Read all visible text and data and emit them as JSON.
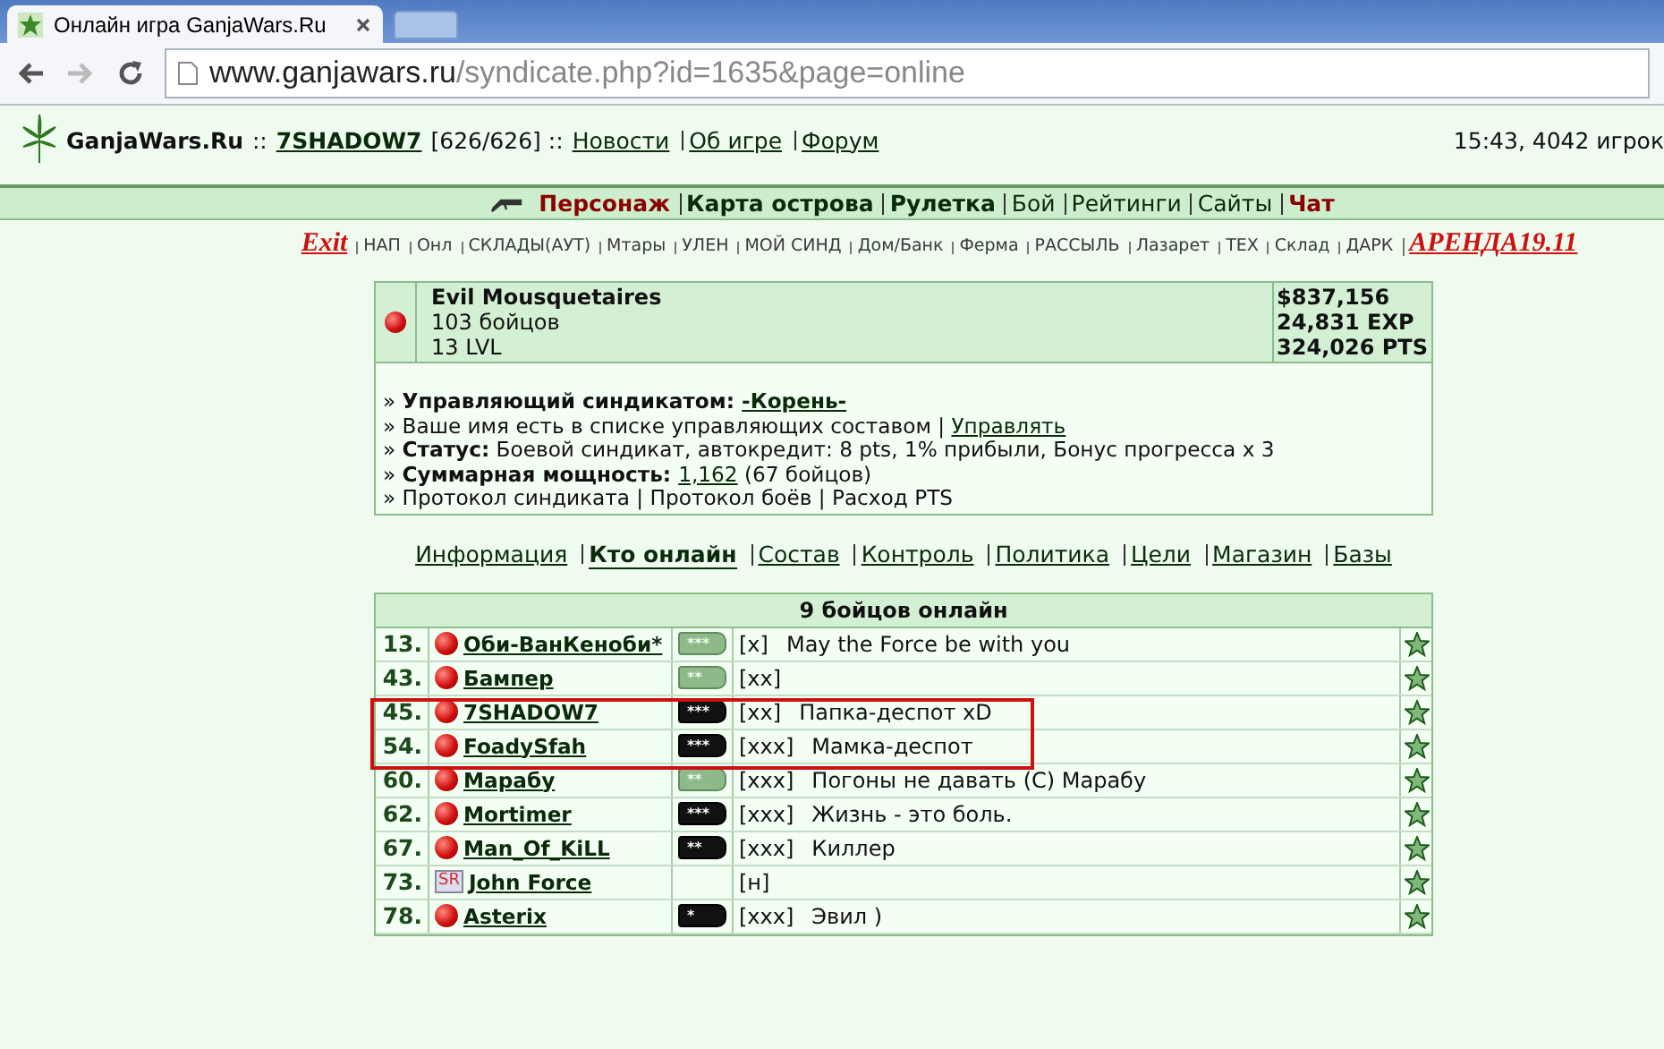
{
  "browser": {
    "tab_title": "Онлайн игра GanjaWars.Ru",
    "url_host": "www.ganjawars.ru",
    "url_path": "/syndicate.php?id=1635&page=online"
  },
  "header": {
    "site": "GanjaWars.Ru",
    "sep1": "::",
    "user": "7SHADOW7",
    "hp": "[626/626] ::",
    "links": [
      "Новости",
      "Об игре",
      "Форум"
    ],
    "status": "15:43, 4042 игрок"
  },
  "main_menu": [
    {
      "label": "Персонаж",
      "kind": "accent"
    },
    {
      "label": "Карта острова",
      "kind": "main"
    },
    {
      "label": "Рулетка",
      "kind": "main"
    },
    {
      "label": "Бой",
      "kind": "plain"
    },
    {
      "label": "Рейтинги",
      "kind": "plain"
    },
    {
      "label": "Сайты",
      "kind": "plain"
    },
    {
      "label": "Чат",
      "kind": "accent"
    }
  ],
  "quick_links": [
    {
      "label": "Exit",
      "kind": "promo"
    },
    {
      "label": "НАП",
      "kind": "plain"
    },
    {
      "label": "Онл",
      "kind": "plain"
    },
    {
      "label": "СКЛАДЫ(АУТ)",
      "kind": "plain"
    },
    {
      "label": "Мтары",
      "kind": "plain"
    },
    {
      "label": "УЛЕН",
      "kind": "plain"
    },
    {
      "label": "МОЙ СИНД",
      "kind": "plain"
    },
    {
      "label": "Дом/Банк",
      "kind": "plain"
    },
    {
      "label": "Ферма",
      "kind": "plain"
    },
    {
      "label": "РАССЫЛЬ",
      "kind": "plain"
    },
    {
      "label": "Лазарет",
      "kind": "plain"
    },
    {
      "label": "ТЕХ",
      "kind": "plain"
    },
    {
      "label": "Склад",
      "kind": "plain"
    },
    {
      "label": "ДАРК",
      "kind": "plain"
    },
    {
      "label": "АРЕНДА19.11",
      "kind": "promo"
    }
  ],
  "syndicate": {
    "name": "Evil Mousquetaires",
    "fighters": "103 бойцов",
    "level": "13 LVL",
    "money": "$837,156",
    "exp": "24,831 EXP",
    "pts": "324,026 PTS",
    "lines": [
      [
        {
          "text": "» ",
          "kind": "plain"
        },
        {
          "text": "Управляющий синдикатом: ",
          "kind": "bold"
        },
        {
          "text": "-Корень-",
          "kind": "bold_link"
        }
      ],
      [
        {
          "text": "» Ваше имя есть в списке управляющих составом | ",
          "kind": "plain"
        },
        {
          "text": "Управлять",
          "kind": "link"
        }
      ],
      [
        {
          "text": "» ",
          "kind": "plain"
        },
        {
          "text": "Статус:",
          "kind": "bold"
        },
        {
          "text": " Боевой синдикат, автокредит: 8 pts, 1% прибыли, Бонус прогресса x 3",
          "kind": "plain"
        }
      ],
      [
        {
          "text": "» ",
          "kind": "plain"
        },
        {
          "text": "Суммарная мощность: ",
          "kind": "bold"
        },
        {
          "text": "1,162",
          "kind": "link"
        },
        {
          "text": " (67 бойцов)",
          "kind": "plain"
        }
      ],
      [
        {
          "text": "» Протокол синдиката | Протокол боёв | Расход PTS",
          "kind": "plain"
        }
      ]
    ]
  },
  "tabs": [
    {
      "label": "Информация",
      "selected": false
    },
    {
      "label": "Кто онлайн",
      "selected": true
    },
    {
      "label": "Состав",
      "selected": false
    },
    {
      "label": "Контроль",
      "selected": false
    },
    {
      "label": "Политика",
      "selected": false
    },
    {
      "label": "Цели",
      "selected": false
    },
    {
      "label": "Магазин",
      "selected": false
    },
    {
      "label": "Базы",
      "selected": false
    }
  ],
  "online": {
    "title": "9 бойцов онлайн",
    "rows": [
      {
        "rank": "13.",
        "kind": "player",
        "name": "Оби-ВанКеноби*",
        "badge": {
          "kind": "green",
          "stars": "***"
        },
        "tag": "[x]",
        "note": "May the Force be with you",
        "highlighted": false
      },
      {
        "rank": "43.",
        "kind": "player",
        "name": "Бампер",
        "badge": {
          "kind": "green",
          "stars": "**"
        },
        "tag": "[xx]",
        "highlighted": false
      },
      {
        "rank": "45.",
        "kind": "player",
        "name": "7SHADOW7",
        "badge": {
          "kind": "black",
          "stars": "***"
        },
        "tag": "[xx]",
        "note": "Папка-деспот xD",
        "highlighted": true
      },
      {
        "rank": "54.",
        "kind": "player",
        "name": "FoadySfah",
        "badge": {
          "kind": "black",
          "stars": "***"
        },
        "tag": "[xxx]",
        "note": "Мамка-деспот",
        "highlighted": true
      },
      {
        "rank": "60.",
        "kind": "player",
        "name": "Марабу",
        "badge": {
          "kind": "green",
          "stars": "**"
        },
        "tag": "[xxx]",
        "note": "Погоны не давать (С) Марабу",
        "highlighted": false
      },
      {
        "rank": "62.",
        "kind": "player",
        "name": "Mortimer",
        "badge": {
          "kind": "black",
          "stars": "***"
        },
        "tag": "[xxx]",
        "note": "Жизнь - это боль.",
        "highlighted": false
      },
      {
        "rank": "67.",
        "kind": "player",
        "name": "Man_Of_KiLL",
        "badge": {
          "kind": "black",
          "stars": "**"
        },
        "tag": "[xxx]",
        "note": "Киллер",
        "highlighted": false
      },
      {
        "rank": "73.",
        "kind": "clan",
        "clan_tag": "SR",
        "name": "John Force",
        "tag": "[н]",
        "highlighted": false
      },
      {
        "rank": "78.",
        "kind": "player",
        "name": "Asterix",
        "badge": {
          "kind": "black",
          "stars": "*"
        },
        "tag": "[xxx]",
        "note": "Эвил )",
        "highlighted": false
      }
    ]
  }
}
